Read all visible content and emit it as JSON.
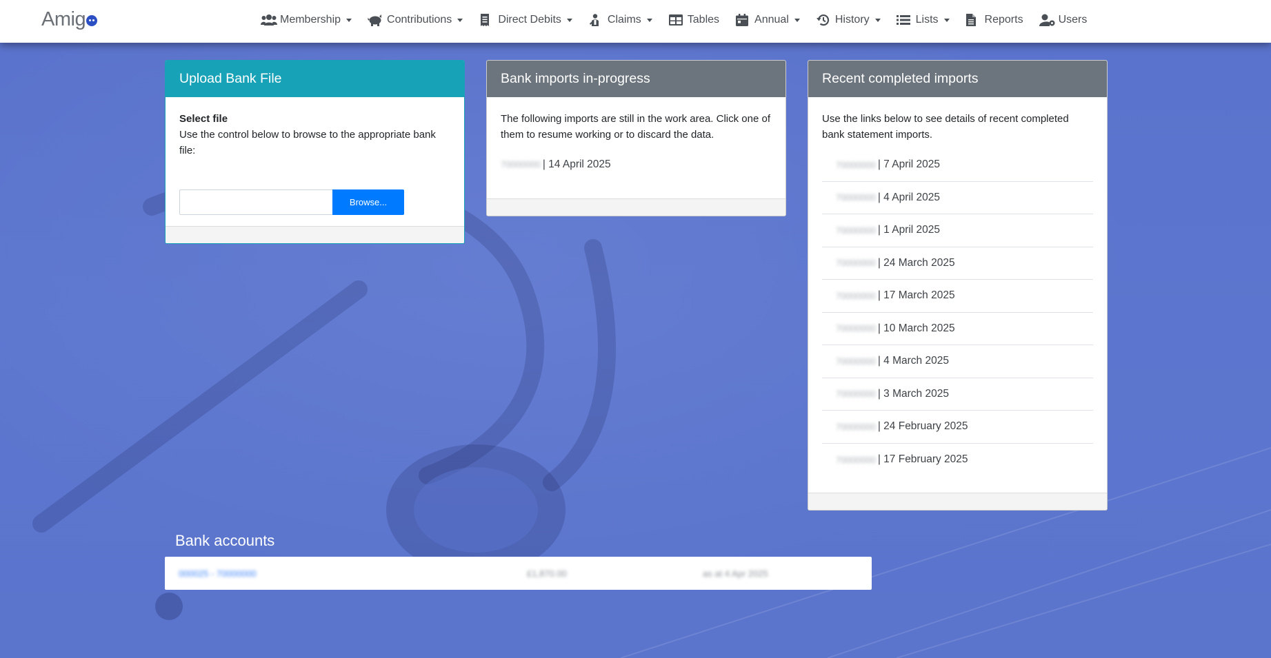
{
  "brand": {
    "name": "Amig"
  },
  "nav": {
    "membership": "Membership",
    "contributions": "Contributions",
    "direct_debits": "Direct Debits",
    "claims": "Claims",
    "tables": "Tables",
    "annual": "Annual",
    "history": "History",
    "lists": "Lists",
    "reports": "Reports",
    "users": "Users"
  },
  "upload": {
    "title": "Upload Bank File",
    "select_label": "Select file",
    "instructions": "Use the control below to browse to the appropriate bank file:",
    "browse_label": "Browse..."
  },
  "in_progress": {
    "title": "Bank imports in-progress",
    "description": "The following imports are still in the work area. Click one of them to resume working or to discard the data.",
    "items": [
      {
        "account": "70000000",
        "date": "| 14 April 2025"
      }
    ]
  },
  "completed": {
    "title": "Recent completed imports",
    "description": "Use the links below to see details of recent completed bank statement imports.",
    "items": [
      {
        "account": "70000000",
        "date": "| 7 April 2025"
      },
      {
        "account": "70000000",
        "date": "| 4 April 2025"
      },
      {
        "account": "70000000",
        "date": "| 1 April 2025"
      },
      {
        "account": "70000000",
        "date": "| 24 March 2025"
      },
      {
        "account": "70000000",
        "date": "| 17 March 2025"
      },
      {
        "account": "70000000",
        "date": "| 10 March 2025"
      },
      {
        "account": "70000000",
        "date": "| 4 March 2025"
      },
      {
        "account": "70000000",
        "date": "| 3 March 2025"
      },
      {
        "account": "70000000",
        "date": "| 24 February 2025"
      },
      {
        "account": "70000000",
        "date": "| 17 February 2025"
      }
    ]
  },
  "bank_accounts": {
    "title": "Bank accounts",
    "rows": [
      {
        "account": "000025 - 70000000",
        "balance": "£1,870.00",
        "as_at": "as at 4 Apr 2025"
      }
    ]
  },
  "colors": {
    "navbar_bg": "#ffffff",
    "page_bg": "#5b74cc",
    "upload_header": "#17a2b8",
    "gray_header": "#6c757d",
    "primary_button": "#007bff",
    "brand_dot": "#2d4fc4"
  }
}
